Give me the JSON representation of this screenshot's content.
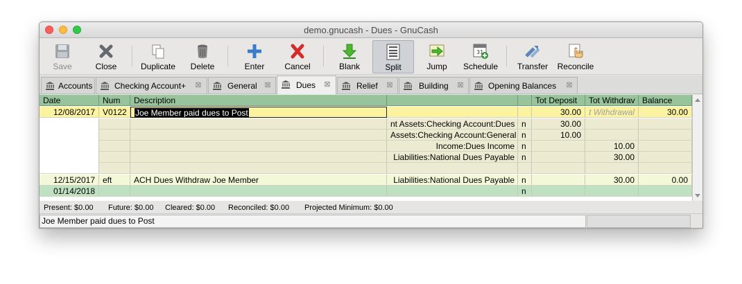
{
  "window": {
    "title": "demo.gnucash - Dues - GnuCash"
  },
  "toolbar": {
    "save": "Save",
    "close": "Close",
    "duplicate": "Duplicate",
    "delete": "Delete",
    "enter": "Enter",
    "cancel": "Cancel",
    "blank": "Blank",
    "split": "Split",
    "jump": "Jump",
    "schedule": "Schedule",
    "schedule_day": "31",
    "transfer": "Transfer",
    "reconcile": "Reconcile"
  },
  "tabs": [
    "Accounts",
    "Checking Account+",
    "General",
    "Dues",
    "Relief",
    "Building",
    "Opening Balances"
  ],
  "active_tab": "Dues",
  "register": {
    "columns": [
      "Date",
      "Num",
      "Description",
      "",
      "",
      "Tot Deposit",
      "Tot Withdrav",
      "Balance"
    ],
    "current_txn": {
      "date": "12/08/2017",
      "num": "V0122",
      "description": "Joe Member paid dues to Post",
      "deposit": "30.00",
      "withdrawal_placeholder": "t Withdrawal",
      "balance": "30.00"
    },
    "splits": [
      {
        "account": "nt Assets:Checking Account:Dues",
        "r": "n",
        "deposit": "30.00",
        "withdrawal": ""
      },
      {
        "account": "Assets:Checking Account:General",
        "r": "n",
        "deposit": "10.00",
        "withdrawal": ""
      },
      {
        "account": "Income:Dues Income",
        "r": "n",
        "deposit": "",
        "withdrawal": "10.00"
      },
      {
        "account": "Liabilities:National Dues Payable",
        "r": "n",
        "deposit": "",
        "withdrawal": "30.00"
      }
    ],
    "txn2": {
      "date": "12/15/2017",
      "num": "eft",
      "description": "ACH Dues Withdraw Joe Member",
      "account": "Liabilities:National Dues Payable",
      "r": "n",
      "deposit": "",
      "withdrawal": "30.00",
      "balance": "0.00"
    },
    "blank_txn": {
      "date": "01/14/2018",
      "r": "n"
    }
  },
  "summary": {
    "present": "Present: $0.00",
    "future": "Future: $0.00",
    "cleared": "Cleared: $0.00",
    "reconciled": "Reconciled: $0.00",
    "projected": "Projected Minimum: $0.00"
  },
  "status": {
    "text": "Joe Member paid dues to Post"
  },
  "colors": {
    "header": "#97c49a",
    "current_row": "#fbf3a0",
    "split_row": "#ecead0",
    "txn_row": "#f3f9d8",
    "blank_row": "#bfe1c2"
  }
}
